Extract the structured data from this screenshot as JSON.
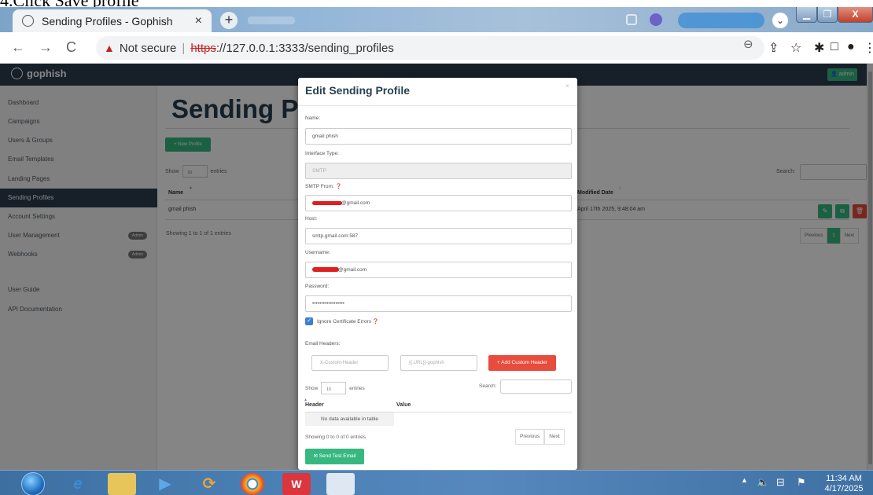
{
  "caption": "4.Click Save profile",
  "browser": {
    "tab_title": "Sending Profiles - Gophish",
    "tab_close": "×",
    "new_tab": "+",
    "window_buttons": {
      "minimize": "▁",
      "maximize": "❐",
      "close": "X"
    },
    "chevron": "⌄",
    "nav": {
      "back": "←",
      "forward": "→",
      "reload": "C"
    },
    "security_warning": "Not secure",
    "url_scheme": "https",
    "url_rest": "://127.0.0.1:3333/sending_profiles",
    "icons": [
      "zoom-icon",
      "share-icon",
      "star-icon",
      "extensions-icon",
      "sidepanel-icon",
      "profile-icon",
      "menu-icon"
    ]
  },
  "app": {
    "brand": "gophish",
    "admin_button": "admin",
    "sidebar": {
      "items": [
        {
          "label": "Dashboard"
        },
        {
          "label": "Campaigns"
        },
        {
          "label": "Users & Groups"
        },
        {
          "label": "Email Templates"
        },
        {
          "label": "Landing Pages"
        },
        {
          "label": "Sending Profiles",
          "active": true
        },
        {
          "label": "Account Settings"
        },
        {
          "label": "User Management",
          "badge": "Admin"
        },
        {
          "label": "Webhooks",
          "badge": "Admin"
        },
        {
          "label": "User Guide"
        },
        {
          "label": "API Documentation"
        }
      ]
    },
    "main": {
      "heading": "Sending Profiles",
      "new_profile_button": "+ New Profile",
      "show_label": "Show",
      "show_value": "10",
      "entries_label": "entries",
      "search_label": "Search:",
      "columns": {
        "name": "Name",
        "modified": "Modified Date"
      },
      "rows": [
        {
          "name": "gmail phish",
          "modified": "April 17th 2025, 9:48:04 am"
        }
      ],
      "showing_text": "Showing 1 to 1 of 1 entries",
      "pagination": {
        "previous": "Previous",
        "current": "1",
        "next": "Next"
      }
    }
  },
  "modal": {
    "title": "Edit Sending Profile",
    "close": "×",
    "fields": {
      "name_label": "Name:",
      "name_value": "gmail phish",
      "interface_label": "Interface Type:",
      "interface_value": "SMTP",
      "smtp_from_label": "SMTP From:",
      "smtp_from_value": "@gmail.com",
      "host_label": "Host:",
      "host_value": "smtp.gmail.com:587",
      "username_label": "Username:",
      "username_value": "@gmail.com",
      "password_label": "Password:",
      "password_value": "••••••••••••••••••"
    },
    "ignore_cert_label": "Ignore Certificate Errors",
    "ignore_cert_checked": true,
    "email_headers_label": "Email Headers:",
    "header_placeholder": "X-Custom-Header",
    "value_placeholder": "{{.URL}}-gophish",
    "add_header_button": "+ Add Custom Header",
    "show_label": "Show",
    "show_value": "10",
    "entries_label": "entries",
    "search_label": "Search:",
    "columns": {
      "header": "Header",
      "value": "Value"
    },
    "no_data": "No data available in table",
    "showing_text": "Showing 0 to 0 of 0 entries",
    "pagination": {
      "previous": "Previous",
      "next": "Next"
    },
    "send_test_button": "Send Test Email"
  },
  "taskbar": {
    "time": "11:34 AM",
    "date": "4/17/2025",
    "apps": [
      "ie-icon",
      "explorer-icon",
      "media-icon",
      "tool-icon",
      "chrome-icon",
      "wps-icon",
      "window-icon"
    ]
  },
  "colors": {
    "navbar": "#2c3e50",
    "primary_green": "#37b881",
    "danger_red": "#e74c3c",
    "not_secure_red": "#c5221f"
  }
}
